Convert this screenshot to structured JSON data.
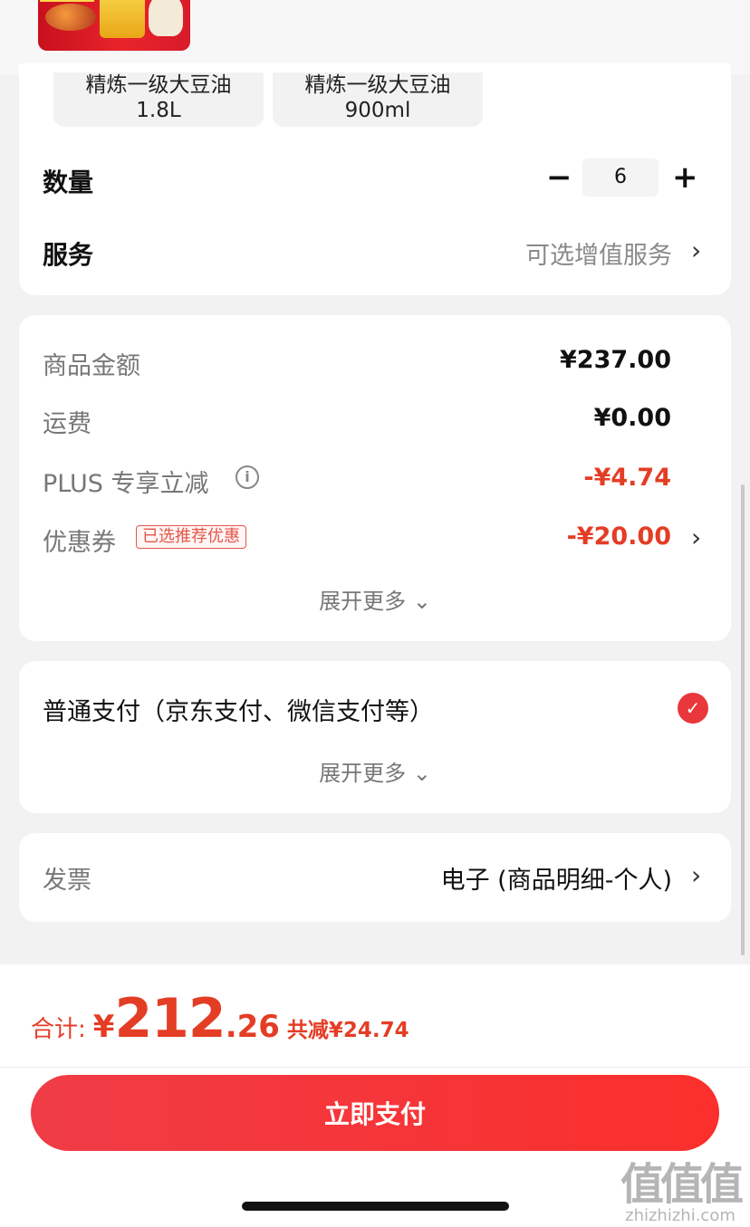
{
  "product": {
    "variants": [
      {
        "line1": "精炼一级大豆油",
        "line2": "1.8L"
      },
      {
        "line1": "精炼一级大豆油",
        "line2": "900ml"
      }
    ]
  },
  "quantity": {
    "label": "数量",
    "minus": "−",
    "value": "6",
    "plus": "+"
  },
  "service": {
    "label": "服务",
    "value": "可选增值服务"
  },
  "price": {
    "goods_label": "商品金额",
    "goods_value": "¥237.00",
    "shipping_label": "运费",
    "shipping_value": "¥0.00",
    "plus_label": "PLUS 专享立减",
    "plus_value": "-¥4.74",
    "coupon_label": "优惠券",
    "coupon_badge": "已选推荐优惠",
    "coupon_value": "-¥20.00",
    "expand": "展开更多"
  },
  "payment": {
    "method": "普通支付（京东支付、微信支付等）",
    "expand": "展开更多"
  },
  "invoice": {
    "label": "发票",
    "value": "电子 (商品明细-个人)"
  },
  "footer": {
    "total_label": "合计:",
    "currency": "¥",
    "total_int": "212",
    "total_dec": ".26",
    "saved": "共减¥24.74",
    "pay_button": "立即支付"
  },
  "watermark": {
    "logo": "值值值",
    "url": "zhizhizhi.com"
  },
  "colors": {
    "accent": "#e43d25",
    "button": "#f5333a"
  }
}
